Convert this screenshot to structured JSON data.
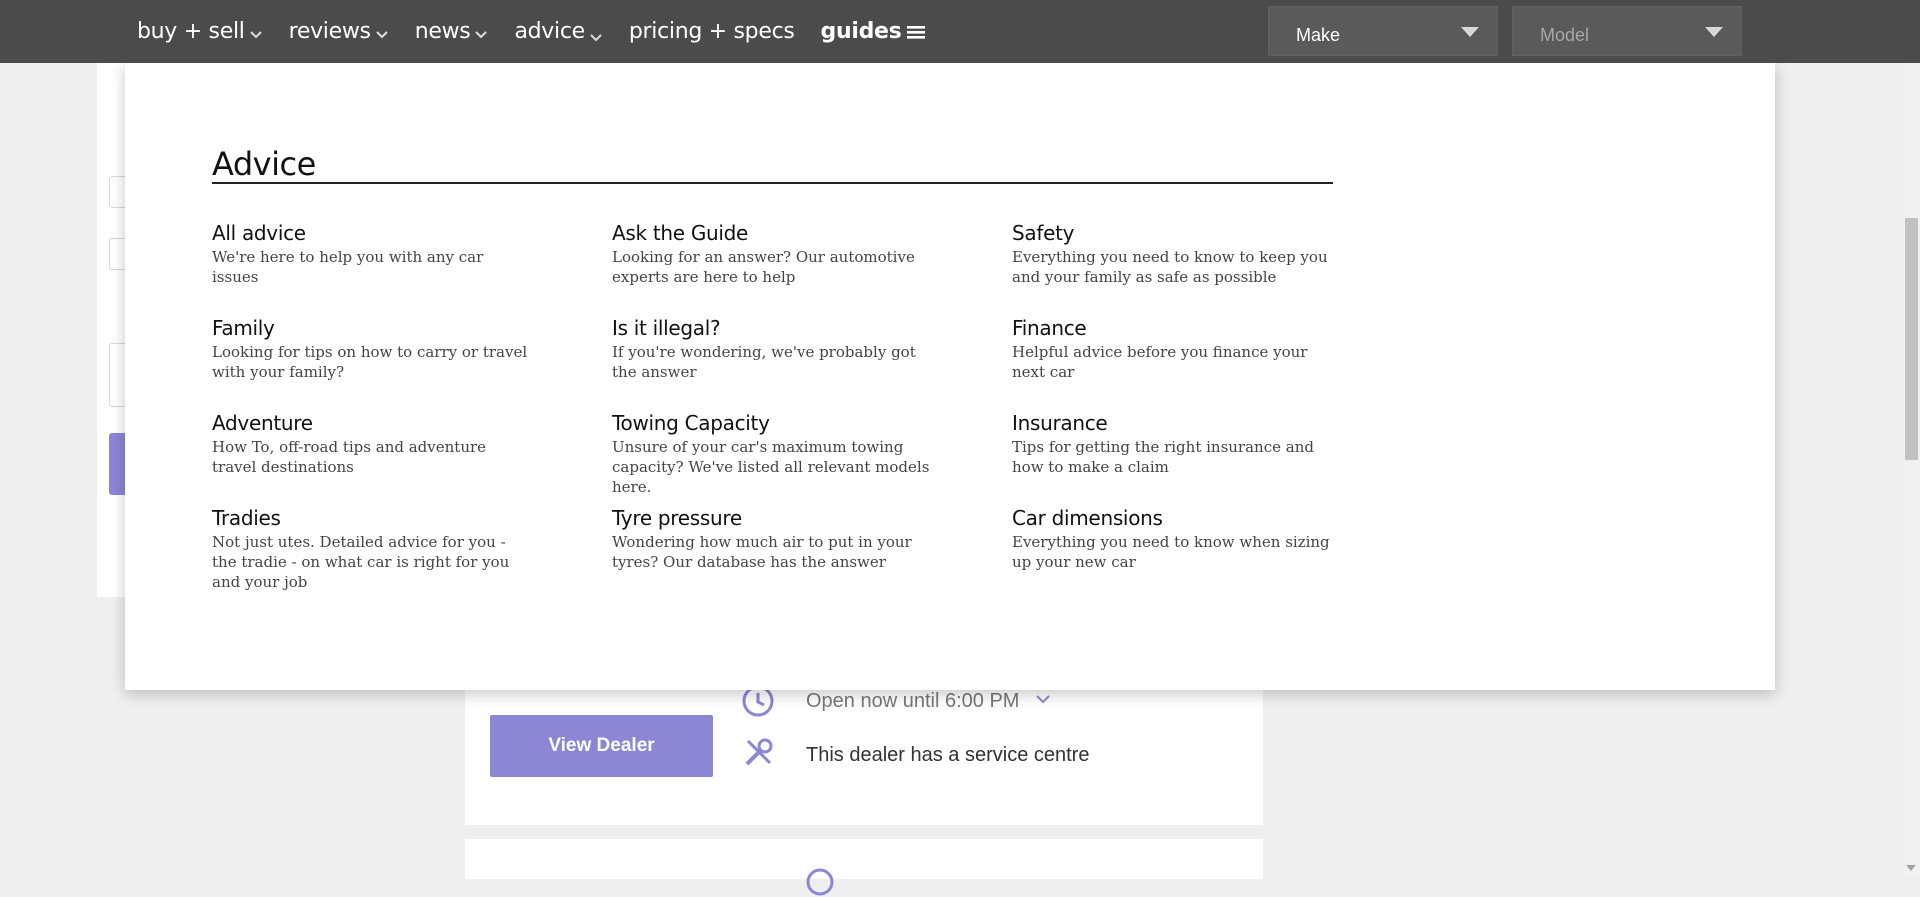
{
  "nav": {
    "items": [
      {
        "label": "buy + sell",
        "has_dropdown": true
      },
      {
        "label": "reviews",
        "has_dropdown": true
      },
      {
        "label": "news",
        "has_dropdown": true
      },
      {
        "label": "advice",
        "has_dropdown": true
      },
      {
        "label": "pricing + specs",
        "has_dropdown": false
      },
      {
        "label": "guides",
        "has_dropdown": false
      }
    ],
    "make_select": "Make",
    "model_select": "Model"
  },
  "mega_menu": {
    "title": "Advice",
    "links": [
      {
        "title": "All advice",
        "desc": "We're here to help you with any car issues"
      },
      {
        "title": "Ask the Guide",
        "desc": "Looking for an answer? Our automotive experts are here to help"
      },
      {
        "title": "Safety",
        "desc": "Everything you need to know to keep you and your family as safe as possible"
      },
      {
        "title": "Family",
        "desc": "Looking for tips on how to carry or travel with your family?"
      },
      {
        "title": "Is it illegal?",
        "desc": "If you're wondering, we've probably got the answer"
      },
      {
        "title": "Finance",
        "desc": "Helpful advice before you finance your next car"
      },
      {
        "title": "Adventure",
        "desc": "How To, off-road tips and adventure travel destinations"
      },
      {
        "title": "Towing Capacity",
        "desc": "Unsure of your car's maximum towing capacity? We've listed all relevant models here."
      },
      {
        "title": "Insurance",
        "desc": "Tips for getting the right insurance and how to make a claim"
      },
      {
        "title": "Tradies",
        "desc": "Not just utes. Detailed advice for you - the tradie - on what car is right for you and your job"
      },
      {
        "title": "Tyre pressure",
        "desc": "Wondering how much air to put in your tyres? Our database has the answer"
      },
      {
        "title": "Car dimensions",
        "desc": "Everything you need to know when sizing up your new car"
      }
    ]
  },
  "dealer": {
    "view_button": "View Dealer",
    "open_status": "Open now until 6:00 PM",
    "service": "This dealer has a service centre"
  },
  "colors": {
    "nav_bg": "#4b4b4b",
    "accent_purple": "#8b86d6"
  },
  "icons": {
    "chevron": "chevron-down-icon",
    "menu": "hamburger-icon",
    "clock": "clock-icon",
    "wrench": "wrench-icon"
  }
}
